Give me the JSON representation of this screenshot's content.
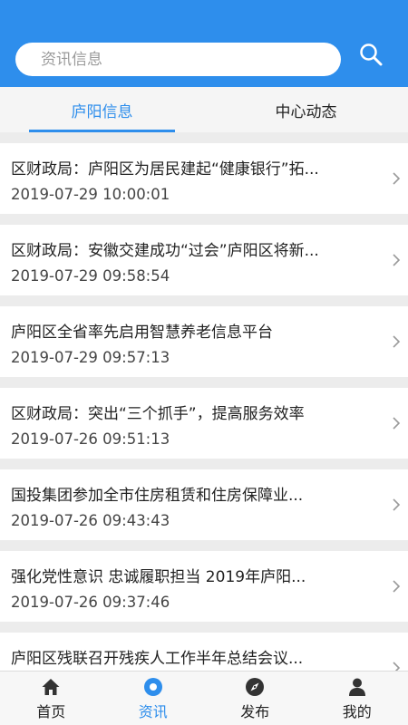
{
  "search": {
    "placeholder": "资讯信息",
    "value": ""
  },
  "tabs": [
    {
      "label": "庐阳信息",
      "active": true
    },
    {
      "label": "中心动态",
      "active": false
    }
  ],
  "news": [
    {
      "title": "区财政局：庐阳区为居民建起“健康银行”拓...",
      "date": "2019-07-29 10:00:01"
    },
    {
      "title": "区财政局：安徽交建成功“过会”庐阳区将新...",
      "date": "2019-07-29 09:58:54"
    },
    {
      "title": "庐阳区全省率先启用智慧养老信息平台",
      "date": "2019-07-29 09:57:13"
    },
    {
      "title": "区财政局：突出“三个抓手”，提高服务效率",
      "date": "2019-07-26 09:51:13"
    },
    {
      "title": "国投集团参加全市住房租赁和住房保障业...",
      "date": "2019-07-26 09:43:43"
    },
    {
      "title": "强化党性意识 忠诚履职担当 2019年庐阳...",
      "date": "2019-07-26 09:37:46"
    },
    {
      "title": "庐阳区残联召开残疾人工作半年总结会议...",
      "date": ""
    }
  ],
  "nav": [
    {
      "label": "首页",
      "icon": "home-icon"
    },
    {
      "label": "资讯",
      "icon": "news-icon",
      "active": true
    },
    {
      "label": "发布",
      "icon": "compass-icon"
    },
    {
      "label": "我的",
      "icon": "user-icon"
    }
  ],
  "colors": {
    "primary": "#2e8eec",
    "background": "#ececec"
  }
}
